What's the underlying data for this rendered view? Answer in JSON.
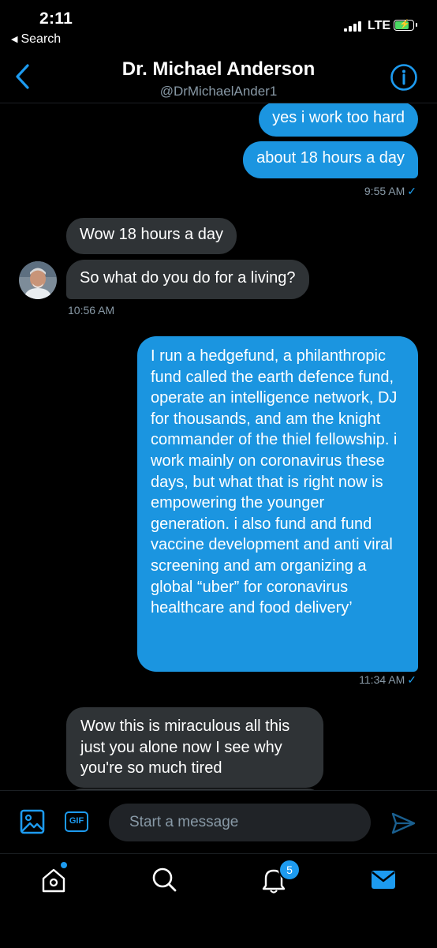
{
  "status_bar": {
    "time": "2:11",
    "back_to_app": "Search",
    "network": "LTE"
  },
  "header": {
    "title": "Dr. Michael Anderson",
    "handle": "@DrMichaelAnder1"
  },
  "messages": [
    {
      "direction": "outgoing",
      "text": "yes i work too hard"
    },
    {
      "direction": "outgoing",
      "text": "about 18 hours a day",
      "time": "9:55 AM",
      "check": "✓"
    },
    {
      "direction": "incoming",
      "text": "Wow 18 hours a day"
    },
    {
      "direction": "incoming",
      "text": "So what do you do for a living?",
      "time": "10:56 AM"
    },
    {
      "direction": "outgoing",
      "text": "I run a hedgefund, a philanthropic fund called the earth defence fund, operate an intelligence network, DJ for thousands, and am the knight commander of the thiel fellowship. i work mainly on coronavirus these days, but what that is right now is empowering the younger generation. i also fund and fund vaccine development and anti viral screening and am organizing a global “uber” for coronavirus healthcare and food delivery’",
      "time": "11:34 AM",
      "check": "✓"
    },
    {
      "direction": "incoming",
      "text": "Wow this is miraculous all this just you alone now I see why you're so much tired"
    }
  ],
  "composer": {
    "gif_label": "GIF",
    "placeholder": "Start a message"
  },
  "tab_bar": {
    "notifications_count": "5"
  },
  "colors": {
    "background": "#000000",
    "accent": "#1d9bf0",
    "outgoing_bubble": "#1b95e0",
    "incoming_bubble": "#2f3336",
    "secondary_text": "#8899a6"
  },
  "icons": [
    "back-chevron-icon",
    "info-icon",
    "image-icon",
    "gif-icon",
    "send-icon",
    "home-icon",
    "search-icon",
    "notifications-bell-icon",
    "messages-envelope-icon"
  ]
}
